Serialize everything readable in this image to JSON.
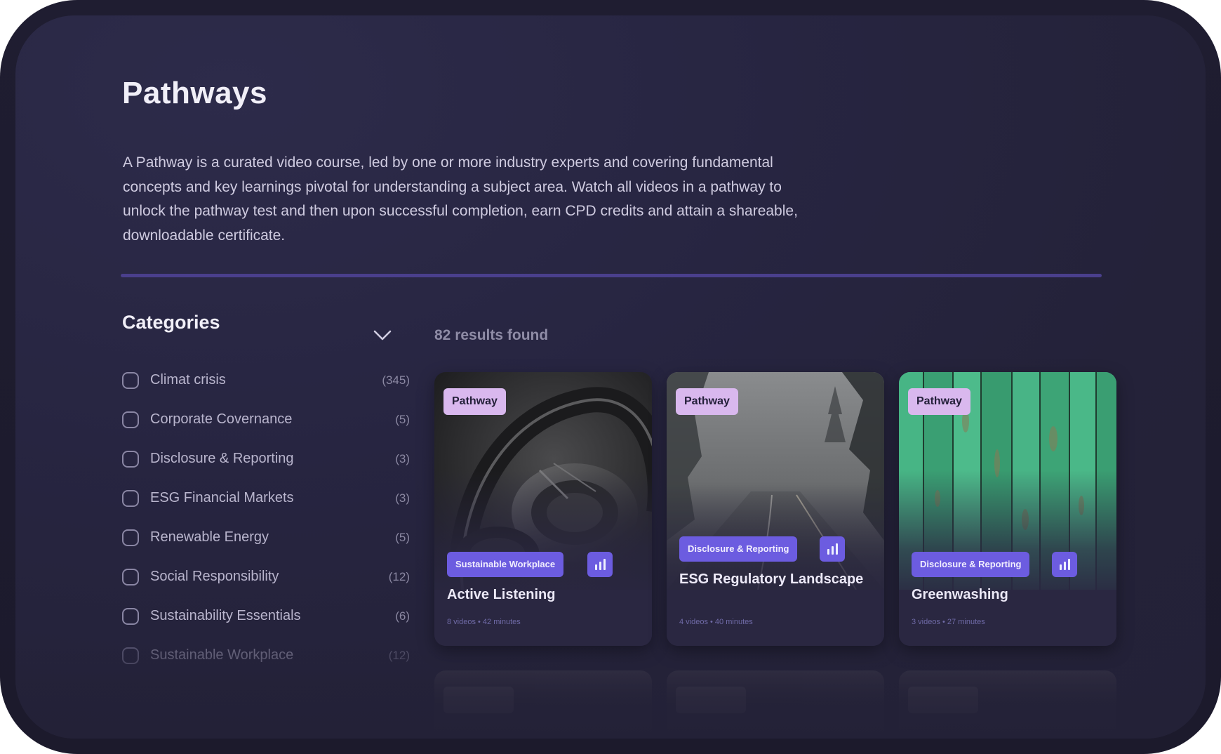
{
  "page": {
    "title": "Pathways",
    "intro": "A Pathway is a curated video course, led by one or more industry experts and covering fundamental concepts and key learnings pivotal for understanding a subject area. Watch all videos in a pathway to unlock the pathway test and then upon successful completion, earn CPD credits and attain a shareable, downloadable certificate."
  },
  "categories": {
    "title": "Categories",
    "toggle_icon": "chevron-down-icon",
    "items": [
      {
        "label": "Climat crisis",
        "count": "(345)"
      },
      {
        "label": "Corporate Covernance",
        "count": "(5)"
      },
      {
        "label": "Disclosure & Reporting",
        "count": "(3)"
      },
      {
        "label": "ESG Financial Markets",
        "count": "(3)"
      },
      {
        "label": "Renewable Energy",
        "count": "(5)"
      },
      {
        "label": "Social Responsibility",
        "count": "(12)"
      },
      {
        "label": "Sustainability Essentials",
        "count": "(6)"
      },
      {
        "label": "Sustainable Workplace",
        "count": "(12)"
      }
    ]
  },
  "results": {
    "text": "82 results found"
  },
  "cards": [
    {
      "badge": "Pathway",
      "tag": "Sustainable Workplace",
      "title": "Active Listening",
      "meta": "8 videos • 42 minutes",
      "image": "headphones"
    },
    {
      "badge": "Pathway",
      "tag": "Disclosure & Reporting",
      "title": "ESG Regulatory Landscape",
      "meta": "4 videos • 40 minutes",
      "image": "foggy-road"
    },
    {
      "badge": "Pathway",
      "tag": "Disclosure & Reporting",
      "title": "Greenwashing",
      "meta": "3 videos • 27 minutes",
      "image": "green-painted-wood"
    }
  ],
  "colors": {
    "accent": "#6c5ce0",
    "badge": "#d9b8ee",
    "background": "#262440",
    "divider": "#4a3f8c"
  }
}
